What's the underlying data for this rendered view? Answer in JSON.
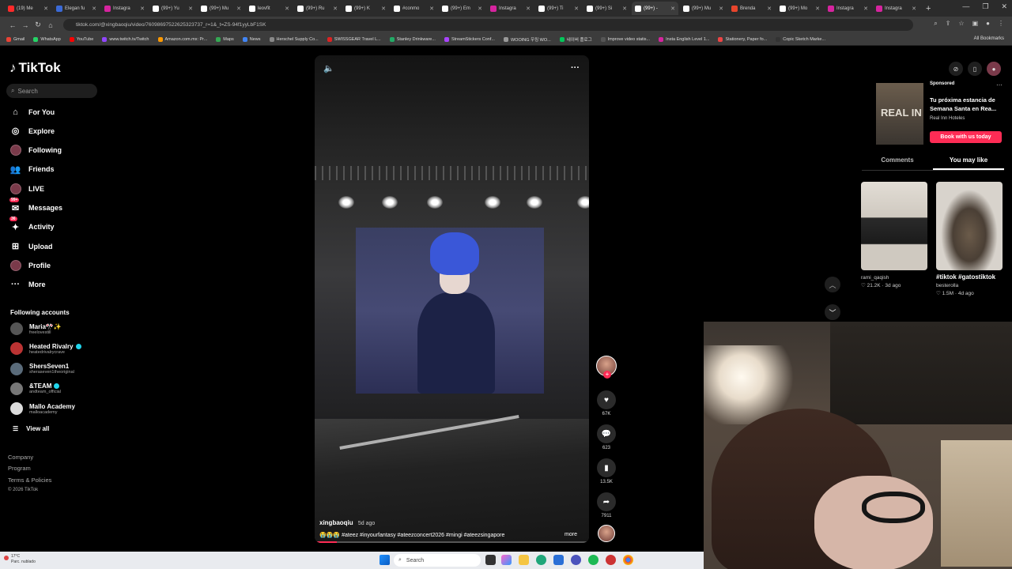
{
  "browser": {
    "tabs": [
      {
        "label": "(19) Me",
        "color": "#ff2a2a"
      },
      {
        "label": "Elegan fu",
        "color": "#3b6ad6"
      },
      {
        "label": "Instagra",
        "color": "#d6249f"
      },
      {
        "label": "(99+) Yu",
        "color": "#ffffff"
      },
      {
        "label": "(99+) Mu",
        "color": "#ffffff"
      },
      {
        "label": "leovfit",
        "color": "#ffffff"
      },
      {
        "label": "(99+) Ru",
        "color": "#ffffff"
      },
      {
        "label": "(99+) K",
        "color": "#ffffff"
      },
      {
        "label": "#conmo",
        "color": "#ffffff"
      },
      {
        "label": "(99+) Em",
        "color": "#ffffff"
      },
      {
        "label": "Instagra",
        "color": "#d6249f"
      },
      {
        "label": "(99+) Ti",
        "color": "#ffffff"
      },
      {
        "label": "(99+) Si",
        "color": "#ffffff"
      },
      {
        "label": "(99+) -",
        "color": "#ffffff",
        "active": true
      },
      {
        "label": "(99+) Mu",
        "color": "#ffffff"
      },
      {
        "label": "Brenda",
        "color": "#e8452c"
      },
      {
        "label": "(99+) Mo",
        "color": "#ffffff"
      },
      {
        "label": "Instagra",
        "color": "#d6249f"
      },
      {
        "label": "Instagra",
        "color": "#d6249f"
      }
    ],
    "url": "tiktok.com/@xingbaoqiu/video/76098697522625323737_r=1&_t=ZS-94f1yyLbF1SK",
    "bookmarks": [
      {
        "label": "Gmail",
        "color": "#ea4335"
      },
      {
        "label": "WhatsApp",
        "color": "#25d366"
      },
      {
        "label": "YouTube",
        "color": "#ff0000"
      },
      {
        "label": "www.twitch.tv/Twitch",
        "color": "#9146ff"
      },
      {
        "label": "Amazon.com.mx: Pr...",
        "color": "#ff9900"
      },
      {
        "label": "Maps",
        "color": "#34a853"
      },
      {
        "label": "News",
        "color": "#4285f4"
      },
      {
        "label": "Herschel Supply Co...",
        "color": "#888888"
      },
      {
        "label": "SWISSGEAR Travel L...",
        "color": "#d22"
      },
      {
        "label": "Stanley Drinkware...",
        "color": "#2a6"
      },
      {
        "label": "StreamStickers Conf...",
        "color": "#a4f"
      },
      {
        "label": "WOOING 우링 WO...",
        "color": "#999"
      },
      {
        "label": "네이버 플로그",
        "color": "#03c75a"
      },
      {
        "label": "Improve video statis...",
        "color": "#555"
      },
      {
        "label": "Insta English Level 1...",
        "color": "#d6249f"
      },
      {
        "label": "Stationery, Paper fo...",
        "color": "#e44"
      },
      {
        "label": "Copic Sketch Marke...",
        "color": "#333"
      }
    ],
    "all_bookmarks": "All Bookmarks"
  },
  "sidebar": {
    "brand": "TikTok",
    "search_placeholder": "Search",
    "nav": [
      {
        "label": "For You",
        "icon": "home-icon"
      },
      {
        "label": "Explore",
        "icon": "compass-icon"
      },
      {
        "label": "Following",
        "icon": "following-icon"
      },
      {
        "label": "Friends",
        "icon": "friends-icon"
      },
      {
        "label": "LIVE",
        "icon": "live-icon"
      },
      {
        "label": "Messages",
        "icon": "messages-icon",
        "badge": "99+"
      },
      {
        "label": "Activity",
        "icon": "activity-icon",
        "badge": "36"
      },
      {
        "label": "Upload",
        "icon": "upload-icon"
      },
      {
        "label": "Profile",
        "icon": "profile-icon"
      },
      {
        "label": "More",
        "icon": "more-icon"
      }
    ],
    "following_title": "Following accounts",
    "accounts": [
      {
        "name": "Maria🎌✨",
        "handle": "freelovestill",
        "verified": false,
        "color": "#555"
      },
      {
        "name": "Heated Rivalry",
        "handle": "heatedrivalrycrave",
        "verified": true,
        "color": "#b33"
      },
      {
        "name": "ShersSeven1",
        "handle": "sheraseven1theoriginal",
        "verified": false,
        "color": "#5a6b7a"
      },
      {
        "name": "&TEAM",
        "handle": "andteam_official",
        "verified": true,
        "color": "#777"
      },
      {
        "name": "Mallo Academy",
        "handle": "malloacademy",
        "verified": false,
        "color": "#ddd"
      }
    ],
    "view_all": "View all",
    "footer": [
      "Company",
      "Program",
      "Terms & Policies",
      "© 2026 TikTok"
    ]
  },
  "video": {
    "author": "xingbaoqiu",
    "time": "5d ago",
    "caption": "😭😭😭 #ateez #inyourfantasy #ateezconcert2026 #mingi #ateezsingapore",
    "more": "more",
    "progress": 0.08
  },
  "actions": {
    "likes": "67K",
    "comments": "623",
    "saves": "13.5K",
    "shares": "7911"
  },
  "right_panel": {
    "sponsor_label": "Sponsored",
    "ad_title": "Tu próxima estancia de Semana Santa en Rea...",
    "ad_brand": "Real Inn Hoteles",
    "ad_button": "Book with us today",
    "ad_image_text": "REAL IN",
    "tabs": [
      "Comments",
      "You may like"
    ],
    "active_tab": 1,
    "recs": [
      {
        "title": "",
        "author": "rami_qaqish",
        "likes": "21.2K",
        "ago": "3d ago",
        "color": "#d9d4cc"
      },
      {
        "title": "#tiktok #gatostiktok",
        "author": "besterolla",
        "likes": "1.5M",
        "ago": "4d ago",
        "color": "#c7c2bb"
      }
    ]
  },
  "taskbar": {
    "weather_temp": "17°C",
    "weather_desc": "Parc. nublado",
    "search": "Search"
  }
}
